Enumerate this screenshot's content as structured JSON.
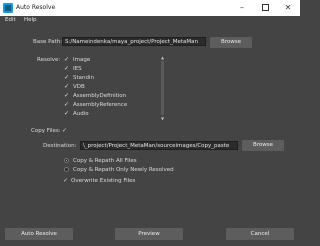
{
  "window": {
    "title": "Auto Resolve",
    "app_icon": "maya-icon"
  },
  "menu": {
    "items": [
      "Edit",
      "Help"
    ]
  },
  "base_path": {
    "label": "Base Path:",
    "value": "S:/Nameindenka/maya_project/Project_MetaMan",
    "browse_label": "Browse"
  },
  "resolve": {
    "label": "Resolve:",
    "items": [
      {
        "label": "Image",
        "checked": true
      },
      {
        "label": "IES",
        "checked": true
      },
      {
        "label": "Standin",
        "checked": true
      },
      {
        "label": "VDB",
        "checked": true
      },
      {
        "label": "AssemblyDefinition",
        "checked": true
      },
      {
        "label": "AssemblyReference",
        "checked": true
      },
      {
        "label": "Audio",
        "checked": true
      }
    ]
  },
  "copy_files": {
    "label": "Copy Files:",
    "checked": true
  },
  "destination": {
    "label": "Destination:",
    "value": "\\_project/Project_MetaMan/sourceimages/Copy_paste",
    "browse_label": "Browse"
  },
  "options": {
    "radio_all": "Copy & Repath All Files",
    "radio_new": "Copy & Repath Only Newly Resolved",
    "selected": "radio_all",
    "overwrite_label": "Overwrite Existing Files",
    "overwrite_checked": true
  },
  "buttons": {
    "auto_resolve": "Auto Resolve",
    "preview": "Preview",
    "cancel": "Cancel"
  },
  "colors": {
    "background": "#444444",
    "field": "#2b2b2b",
    "button": "#5d5d5d",
    "titlebar": "#ffffff"
  }
}
